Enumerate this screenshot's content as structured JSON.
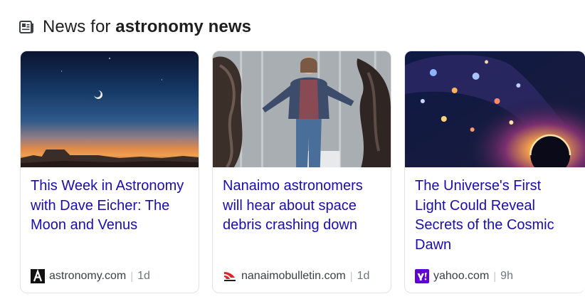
{
  "header": {
    "prefix": "News for ",
    "query": "astronomy news",
    "icon": "newspaper-icon"
  },
  "cards": [
    {
      "title": "This Week in Astronomy with Dave Eicher: The Moon and Venus",
      "source": "astronomy.com",
      "separator": "|",
      "age": "1d",
      "favicon": "astronomy-logo-icon",
      "image": "twilight-moon-venus-image"
    },
    {
      "title": "Nanaimo astronomers will hear about space debris crashing down",
      "source": "nanaimobulletin.com",
      "separator": "|",
      "age": "1d",
      "favicon": "nanaimo-bulletin-logo-icon",
      "image": "space-debris-photo"
    },
    {
      "title": "The Universe's First Light Could Reveal Secrets of the Cosmic Dawn",
      "source": "yahoo.com",
      "separator": "|",
      "age": "9h",
      "favicon": "yahoo-logo-icon",
      "image": "cosmic-dawn-illustration"
    }
  ],
  "colors": {
    "title_link": "#1a0dab",
    "source_text": "#3c4043",
    "card_border": "#e3e3e3",
    "yahoo_purple": "#6001d2"
  }
}
